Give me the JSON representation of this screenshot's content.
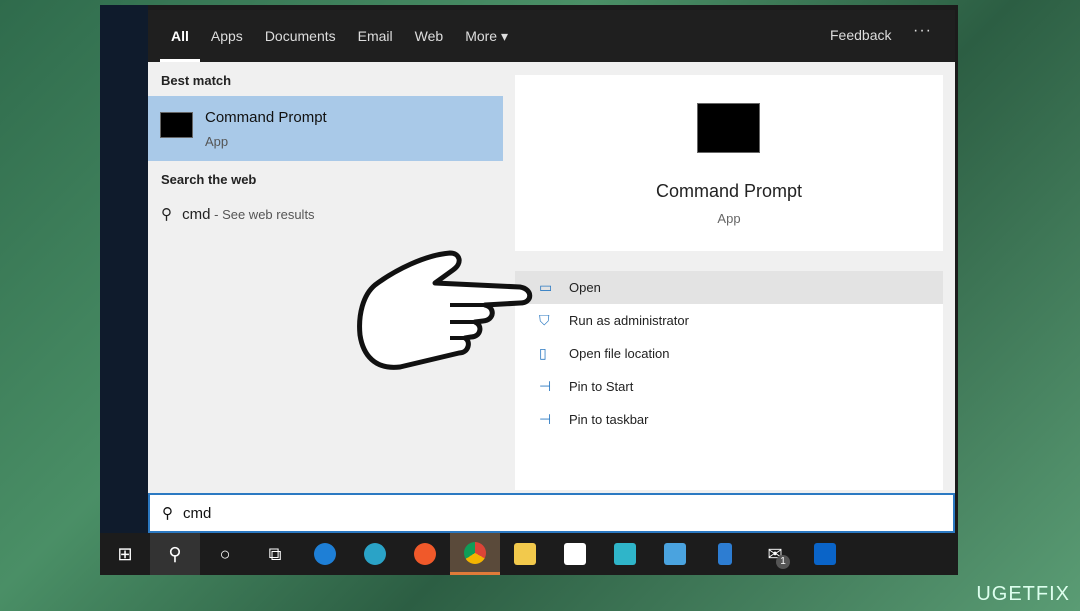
{
  "tabs": [
    "All",
    "Apps",
    "Documents",
    "Email",
    "Web",
    "More ▾"
  ],
  "feedback": "Feedback",
  "more_dots": "···",
  "left": {
    "best_match_header": "Best match",
    "best_title": "Command Prompt",
    "best_sub": "App",
    "web_header": "Search the web",
    "web_query": "cmd",
    "web_suffix": " - See web results"
  },
  "right": {
    "title": "Command Prompt",
    "sub": "App",
    "actions": [
      {
        "label": "Open",
        "icon": "open-icon"
      },
      {
        "label": "Run as administrator",
        "icon": "shield-icon"
      },
      {
        "label": "Open file location",
        "icon": "folder-icon"
      },
      {
        "label": "Pin to Start",
        "icon": "pin-icon"
      },
      {
        "label": "Pin to taskbar",
        "icon": "pin-icon"
      }
    ]
  },
  "search": {
    "value": "cmd"
  },
  "taskbar": {
    "mail_badge": "1"
  },
  "watermark": "UGETFIX",
  "colors": {
    "accent": "#2b79c2",
    "selected": "#a9c9e8"
  }
}
